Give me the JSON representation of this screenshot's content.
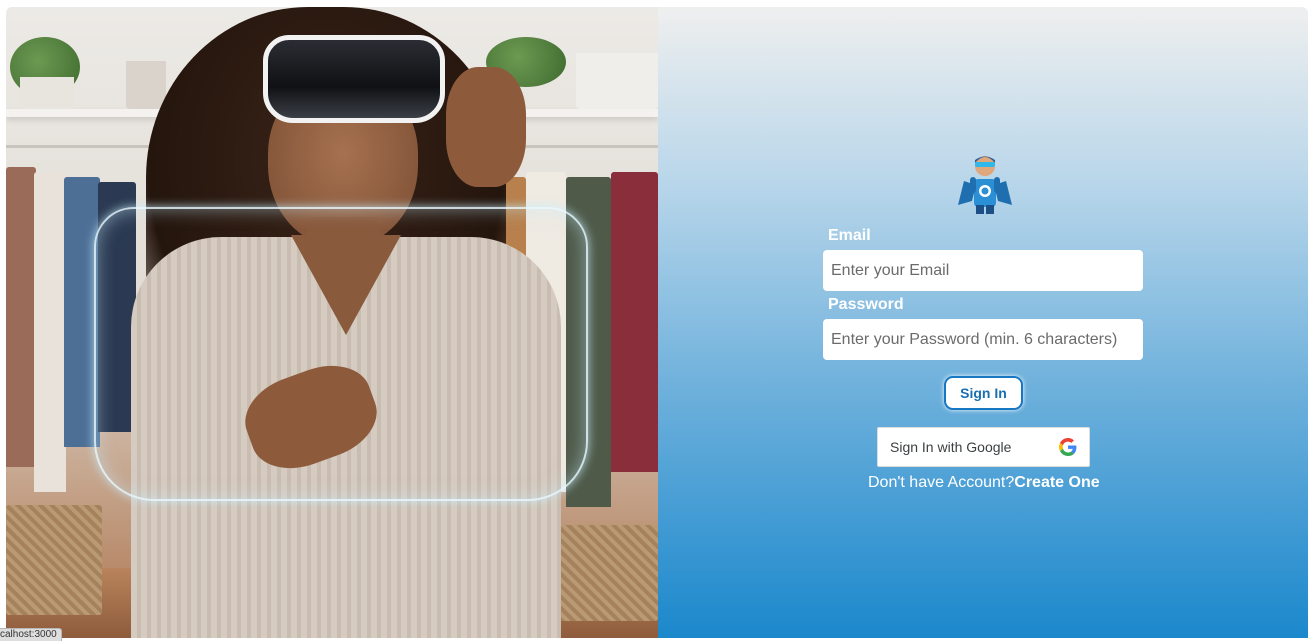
{
  "hero": {
    "image_alt": "Woman wearing a VR headset with a holographic sweater outline in front of a clothing rack"
  },
  "brand": {
    "logo_icon": "superhero-mascot-icon"
  },
  "form": {
    "email_label": "Email",
    "email_placeholder": "Enter your Email",
    "email_value": "",
    "password_label": "Password",
    "password_placeholder": "Enter your Password (min. 6 characters)",
    "password_value": "",
    "signin_label": "Sign In",
    "google_label": "Sign In with Google",
    "google_icon": "google-g-icon",
    "no_account_text": "Don't have Account?",
    "create_link": "Create One"
  },
  "colors": {
    "panel_top": "#efefef",
    "panel_bottom": "#1b88cc",
    "accent": "#1877c2"
  },
  "statusbar": {
    "url": "calhost:3000"
  }
}
